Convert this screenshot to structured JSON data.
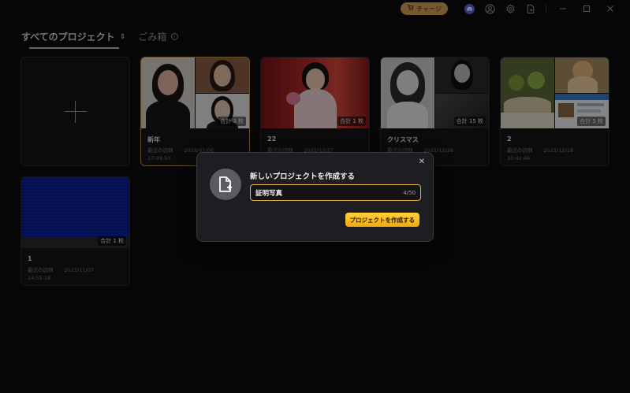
{
  "titlebar": {
    "charge_label": "チャージ",
    "icons": [
      "cart-icon",
      "discord-icon",
      "user-icon",
      "gear-icon",
      "export-icon",
      "minimize-icon",
      "maximize-icon",
      "close-icon"
    ]
  },
  "tabs": [
    {
      "label": "すべてのプロジェクト",
      "sort_glyph": "⇕",
      "active": true
    },
    {
      "label": "ごみ箱",
      "info_glyph": "i",
      "active": false
    }
  ],
  "projects": [
    {
      "name": "新年",
      "count": "合計 3 枚",
      "meta_label": "最近の訪問",
      "meta_date": "2026/01/06",
      "meta_time": "17:49:50",
      "selected": true
    },
    {
      "name": "22",
      "count": "合計 1 枚",
      "meta_label": "最近の訪問",
      "meta_date": "2025/12/27",
      "meta_time": "",
      "selected": false
    },
    {
      "name": "クリスマス",
      "count": "合計 15 枚",
      "meta_label": "最近の訪問",
      "meta_date": "2025/12/26",
      "meta_time": "",
      "selected": false
    },
    {
      "name": "2",
      "count": "合計 5 枚",
      "meta_label": "最近の訪問",
      "meta_date": "2025/12/18",
      "meta_time": "10:42:46",
      "selected": false
    },
    {
      "name": "1",
      "count": "合計 1 枚",
      "meta_label": "最近の訪問",
      "meta_date": "2025/11/07",
      "meta_time": "14:55:18",
      "selected": false
    }
  ],
  "dialog": {
    "title": "新しいプロジェクトを作成する",
    "input_value": "証明写真",
    "counter": "4/50",
    "create_label": "プロジェクトを作成する",
    "close_glyph": "✕"
  },
  "colors": {
    "accent": "#f2b21b",
    "charge": "#d9a25a",
    "selected_border": "#b8923a",
    "background": "#0b0b0d"
  }
}
